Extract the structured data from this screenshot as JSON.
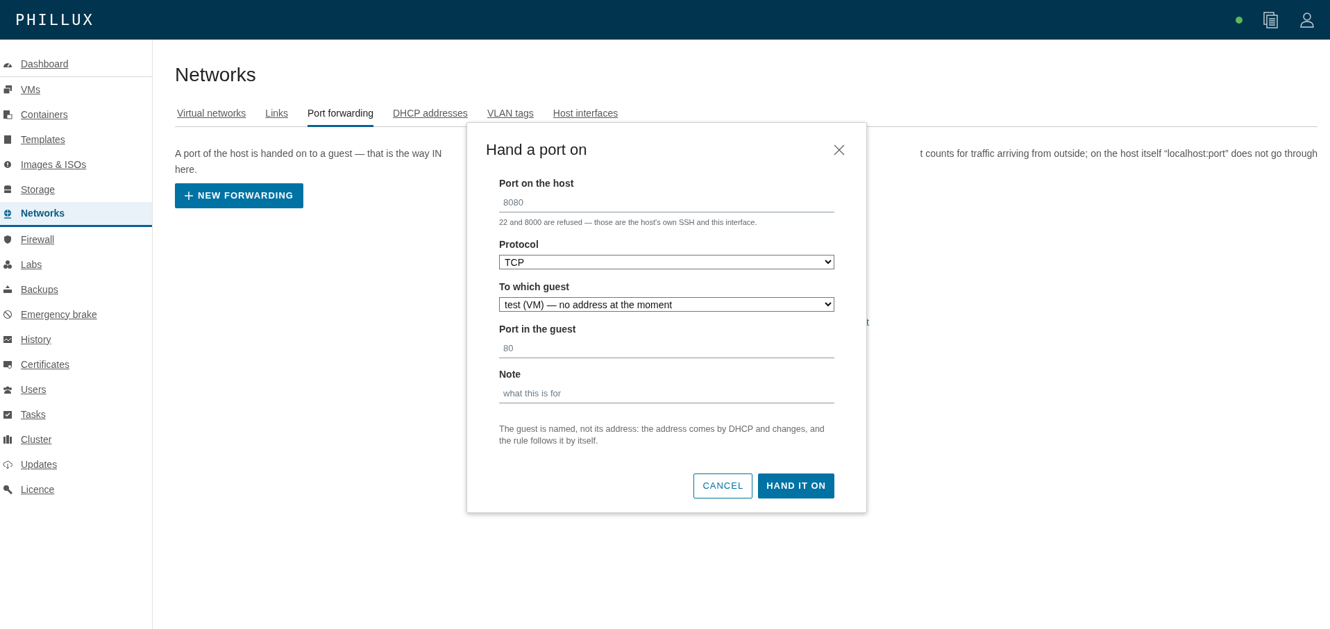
{
  "header": {
    "logo": "PHILLUX"
  },
  "sidebar": {
    "items": [
      {
        "label": "Dashboard",
        "selected": false
      },
      {
        "label": "VMs",
        "selected": false
      },
      {
        "label": "Containers",
        "selected": false
      },
      {
        "label": "Templates",
        "selected": false
      },
      {
        "label": "Images & ISOs",
        "selected": false
      },
      {
        "label": "Storage",
        "selected": false
      },
      {
        "label": "Networks",
        "selected": true
      },
      {
        "label": "Firewall",
        "selected": false
      },
      {
        "label": "Labs",
        "selected": false
      },
      {
        "label": "Backups",
        "selected": false
      },
      {
        "label": "Emergency brake",
        "selected": false
      },
      {
        "label": "History",
        "selected": false
      },
      {
        "label": "Certificates",
        "selected": false
      },
      {
        "label": "Users",
        "selected": false
      },
      {
        "label": "Tasks",
        "selected": false
      },
      {
        "label": "Cluster",
        "selected": false
      },
      {
        "label": "Updates",
        "selected": false
      },
      {
        "label": "Licence",
        "selected": false
      }
    ]
  },
  "page": {
    "title": "Networks",
    "tabs": [
      {
        "label": "Virtual networks",
        "selected": false
      },
      {
        "label": "Links",
        "selected": false
      },
      {
        "label": "Port forwarding",
        "selected": true
      },
      {
        "label": "DHCP addresses",
        "selected": false
      },
      {
        "label": "VLAN tags",
        "selected": false
      },
      {
        "label": "Host interfaces",
        "selected": false
      }
    ],
    "description": {
      "line_1_left": "A port of the host is handed on to a guest — that is the way IN",
      "line_1_right": "t counts for traffic arriving from outside; on the host itself “localhost:port” does not go through",
      "line_2": "here."
    },
    "new_button": "NEW FORWARDING",
    "partial_text": "t"
  },
  "dialog": {
    "title": "Hand a port on",
    "fields": [
      {
        "kind": "text",
        "label": "Port on the host",
        "placeholder": "8080",
        "hint": "22 and 8000 are refused — those are the host's own SSH and this interface."
      },
      {
        "kind": "select",
        "label": "Protocol",
        "value": "TCP"
      },
      {
        "kind": "select",
        "label": "To which guest",
        "value": "test (VM) — no address at the moment"
      },
      {
        "kind": "text",
        "label": "Port in the guest",
        "placeholder": "80"
      },
      {
        "kind": "text",
        "label": "Note",
        "placeholder": "what this is for"
      }
    ],
    "note": "The guest is named, not its address: the address comes by DHCP and changes, and the rule follows it by itself.",
    "buttons": [
      {
        "kind": "secondary",
        "label": "CANCEL"
      },
      {
        "kind": "primary",
        "label": "HAND IT ON"
      }
    ]
  }
}
